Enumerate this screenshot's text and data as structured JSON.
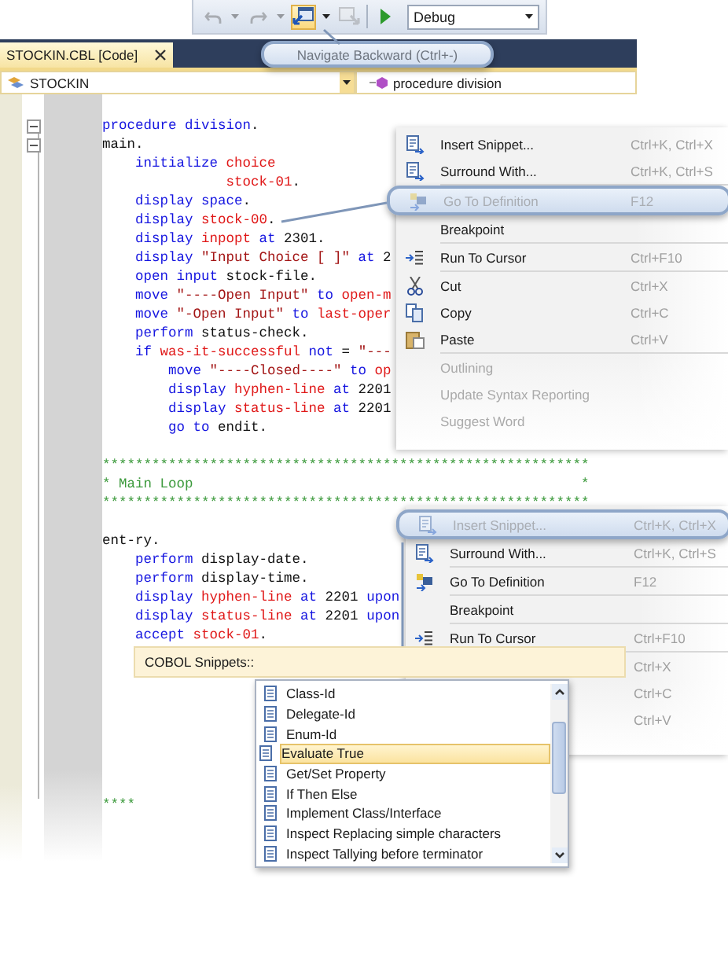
{
  "toolbar": {
    "buttons": [
      {
        "kind": "undo",
        "disabled": true,
        "highlighted": false
      },
      {
        "kind": "dropdown",
        "disabled": true,
        "highlighted": false
      },
      {
        "kind": "redo",
        "disabled": true,
        "highlighted": false
      },
      {
        "kind": "dropdown",
        "disabled": true,
        "highlighted": false
      },
      {
        "kind": "navigate",
        "disabled": false,
        "highlighted": true
      },
      {
        "kind": "dropdown",
        "disabled": false,
        "highlighted": false
      },
      {
        "kind": "forward",
        "disabled": true,
        "highlighted": false
      },
      {
        "kind": "start",
        "disabled": false,
        "highlighted": false
      }
    ],
    "configuration": "Debug"
  },
  "tooltip": "Navigate Backward (Ctrl+-)",
  "editor": {
    "tab": {
      "title": "STOCKIN.CBL [Code]"
    },
    "type_selector": "STOCKIN",
    "member_selector": "procedure division",
    "code_blocks": [
      {
        "lines": [
          {
            "tokens": [
              {
                "kind": "kw",
                "text": "procedure division"
              },
              {
                "kind": "txt",
                "text": "."
              }
            ]
          },
          {
            "tokens": [
              {
                "kind": "txt",
                "text": "main."
              }
            ]
          },
          {
            "tokens": [
              {
                "kind": "kw",
                "text": "    initialize "
              },
              {
                "kind": "id",
                "text": "choice"
              }
            ]
          },
          {
            "tokens": [
              {
                "kind": "id",
                "text": "               stock-01"
              },
              {
                "kind": "txt",
                "text": "."
              }
            ]
          },
          {
            "tokens": [
              {
                "kind": "kw",
                "text": "    display space"
              },
              {
                "kind": "txt",
                "text": "."
              }
            ]
          },
          {
            "tokens": [
              {
                "kind": "kw",
                "text": "    display "
              },
              {
                "kind": "id",
                "text": "stock-00"
              },
              {
                "kind": "txt",
                "text": "."
              }
            ]
          },
          {
            "tokens": [
              {
                "kind": "kw",
                "text": "    display "
              },
              {
                "kind": "id",
                "text": "inpopt"
              },
              {
                "kind": "kw",
                "text": " at "
              },
              {
                "kind": "txt",
                "text": "2301."
              }
            ]
          },
          {
            "tokens": [
              {
                "kind": "kw",
                "text": "    display "
              },
              {
                "kind": "str",
                "text": "\"Input Choice [ ]\""
              },
              {
                "kind": "kw",
                "text": " at "
              },
              {
                "kind": "txt",
                "text": "2"
              }
            ]
          },
          {
            "tokens": [
              {
                "kind": "kw",
                "text": "    open input "
              },
              {
                "kind": "txt",
                "text": "stock-file."
              }
            ]
          },
          {
            "tokens": [
              {
                "kind": "kw",
                "text": "    move "
              },
              {
                "kind": "str",
                "text": "\"----Open Input\""
              },
              {
                "kind": "kw",
                "text": " to "
              },
              {
                "kind": "id",
                "text": "open-m"
              }
            ]
          },
          {
            "tokens": [
              {
                "kind": "kw",
                "text": "    move "
              },
              {
                "kind": "str",
                "text": "\"-Open Input\""
              },
              {
                "kind": "kw",
                "text": " to "
              },
              {
                "kind": "id",
                "text": "last-oper"
              }
            ]
          },
          {
            "tokens": [
              {
                "kind": "kw",
                "text": "    perform "
              },
              {
                "kind": "txt",
                "text": "status-check."
              }
            ]
          },
          {
            "tokens": [
              {
                "kind": "kw",
                "text": "    if "
              },
              {
                "kind": "id",
                "text": "was-it-successful"
              },
              {
                "kind": "kw",
                "text": " not "
              },
              {
                "kind": "txt",
                "text": "= "
              },
              {
                "kind": "str",
                "text": "\"---"
              }
            ]
          },
          {
            "tokens": [
              {
                "kind": "kw",
                "text": "        move "
              },
              {
                "kind": "str",
                "text": "\"----Closed----\""
              },
              {
                "kind": "kw",
                "text": " to "
              },
              {
                "kind": "id",
                "text": "op"
              }
            ]
          },
          {
            "tokens": [
              {
                "kind": "kw",
                "text": "        display "
              },
              {
                "kind": "id",
                "text": "hyphen-line"
              },
              {
                "kind": "kw",
                "text": " at "
              },
              {
                "kind": "txt",
                "text": "2201"
              }
            ]
          },
          {
            "tokens": [
              {
                "kind": "kw",
                "text": "        display "
              },
              {
                "kind": "id",
                "text": "status-line"
              },
              {
                "kind": "kw",
                "text": " at "
              },
              {
                "kind": "txt",
                "text": "2201"
              }
            ]
          },
          {
            "tokens": [
              {
                "kind": "kw",
                "text": "        go to "
              },
              {
                "kind": "txt",
                "text": "endit."
              }
            ]
          }
        ]
      },
      {
        "lines": [
          {
            "tokens": [
              {
                "kind": "cmt",
                "text": "***********************************************************"
              }
            ]
          },
          {
            "tokens": [
              {
                "kind": "cmt",
                "text": "* Main Loop                                               *"
              }
            ]
          },
          {
            "tokens": [
              {
                "kind": "cmt",
                "text": "***********************************************************"
              }
            ]
          }
        ]
      },
      {
        "lines": [
          {
            "tokens": [
              {
                "kind": "txt",
                "text": "ent-ry."
              }
            ]
          },
          {
            "tokens": [
              {
                "kind": "kw",
                "text": "    perform "
              },
              {
                "kind": "txt",
                "text": "display-date."
              }
            ]
          },
          {
            "tokens": [
              {
                "kind": "kw",
                "text": "    perform "
              },
              {
                "kind": "txt",
                "text": "display-time."
              }
            ]
          },
          {
            "tokens": [
              {
                "kind": "kw",
                "text": "    display "
              },
              {
                "kind": "id",
                "text": "hyphen-line"
              },
              {
                "kind": "kw",
                "text": " at "
              },
              {
                "kind": "txt",
                "text": "2201"
              },
              {
                "kind": "kw",
                "text": " upon"
              }
            ]
          },
          {
            "tokens": [
              {
                "kind": "kw",
                "text": "    display "
              },
              {
                "kind": "id",
                "text": "status-line"
              },
              {
                "kind": "kw",
                "text": " at "
              },
              {
                "kind": "txt",
                "text": "2201"
              },
              {
                "kind": "kw",
                "text": " upon"
              }
            ]
          },
          {
            "tokens": [
              {
                "kind": "kw",
                "text": "    accept "
              },
              {
                "kind": "id",
                "text": "stock-01"
              },
              {
                "kind": "txt",
                "text": "."
              }
            ]
          }
        ]
      },
      {
        "lines": [
          {
            "tokens": [
              {
                "kind": "cmt",
                "text": "****"
              }
            ]
          }
        ]
      }
    ]
  },
  "context_menu": {
    "items": [
      {
        "kind": "snippet",
        "label": "Insert Snippet...",
        "shortcut": "Ctrl+K, Ctrl+X",
        "disabled": false,
        "callout": false,
        "faded": false,
        "separator_after": false
      },
      {
        "kind": "surround",
        "label": "Surround With...",
        "shortcut": "Ctrl+K, Ctrl+S",
        "disabled": false,
        "callout": false,
        "faded": false,
        "separator_after": true
      },
      {
        "kind": "definition",
        "label": "Go To Definition",
        "shortcut": "F12",
        "disabled": true,
        "callout": true,
        "faded": false,
        "separator_after": false
      },
      {
        "kind": "plain",
        "label": "Breakpoint",
        "disabled": false,
        "callout": false,
        "faded": false,
        "separator_after": true
      },
      {
        "kind": "cursor",
        "label": "Run To Cursor",
        "shortcut": "Ctrl+F10",
        "disabled": false,
        "callout": false,
        "faded": false,
        "separator_after": true
      },
      {
        "kind": "cut",
        "label": "Cut",
        "shortcut": "Ctrl+X",
        "disabled": false,
        "callout": false,
        "faded": false,
        "separator_after": false
      },
      {
        "kind": "copy",
        "label": "Copy",
        "shortcut": "Ctrl+C",
        "disabled": false,
        "callout": false,
        "faded": false,
        "separator_after": false
      },
      {
        "kind": "paste",
        "label": "Paste",
        "shortcut": "Ctrl+V",
        "disabled": false,
        "callout": false,
        "faded": false,
        "separator_after": true
      },
      {
        "kind": "plain",
        "label": "Outlining",
        "disabled": false,
        "callout": false,
        "faded": true,
        "separator_after": false
      },
      {
        "kind": "plain",
        "label": "Update Syntax Reporting",
        "disabled": false,
        "callout": false,
        "faded": true,
        "separator_after": false
      },
      {
        "kind": "plain",
        "label": "Suggest Word",
        "disabled": false,
        "callout": false,
        "faded": true,
        "separator_after": false
      }
    ]
  },
  "second_context_menu": {
    "items": [
      {
        "kind": "snippet",
        "label": "Insert Snippet...",
        "shortcut": "Ctrl+K, Ctrl+X",
        "disabled": true,
        "callout": true,
        "separator_after": false
      },
      {
        "kind": "surround",
        "label": "Surround With...",
        "shortcut": "Ctrl+K, Ctrl+S",
        "disabled": false,
        "callout": false,
        "separator_after": true
      },
      {
        "kind": "definition",
        "label": "Go To Definition",
        "shortcut": "F12",
        "disabled": false,
        "callout": false,
        "separator_after": true
      },
      {
        "kind": "plain",
        "label": "Breakpoint",
        "disabled": false,
        "callout": false,
        "separator_after": true
      },
      {
        "kind": "cursor",
        "label": "Run To Cursor",
        "shortcut": "Ctrl+F10",
        "disabled": false,
        "callout": false,
        "separator_after": true
      },
      {
        "kind": "hidden",
        "shortcut": "Ctrl+X",
        "disabled": false,
        "callout": false,
        "separator_after": false
      },
      {
        "kind": "hidden",
        "shortcut": "Ctrl+C",
        "disabled": false,
        "callout": false,
        "separator_after": false
      },
      {
        "kind": "hidden",
        "shortcut": "Ctrl+V",
        "disabled": false,
        "callout": false,
        "separator_after": false
      }
    ]
  },
  "snippet_picker": {
    "title": "COBOL Snippets::",
    "items": [
      {
        "label": "Class-Id",
        "selected": false
      },
      {
        "label": "Delegate-Id",
        "selected": false
      },
      {
        "label": "Enum-Id",
        "selected": false
      },
      {
        "label": "Evaluate True",
        "selected": true
      },
      {
        "label": "Get/Set Property",
        "selected": false
      },
      {
        "label": "If Then Else",
        "selected": false
      },
      {
        "label": "Implement Class/Interface",
        "selected": false
      },
      {
        "label": "Inspect Replacing simple characters",
        "selected": false
      },
      {
        "label": "Inspect Tallying before terminator",
        "selected": false
      }
    ]
  }
}
